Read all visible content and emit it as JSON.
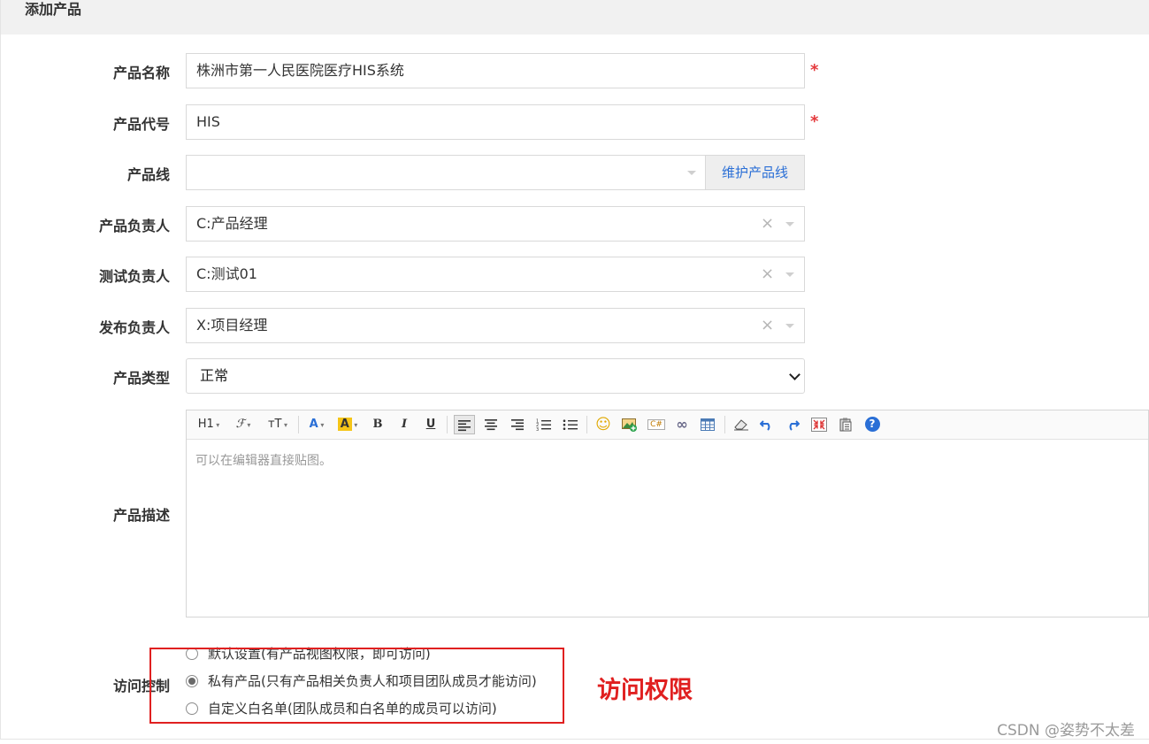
{
  "page": {
    "title": "添加产品"
  },
  "form": {
    "name": {
      "label": "产品名称",
      "value": "株洲市第一人民医院医疗HIS系统",
      "required_mark": "*"
    },
    "code": {
      "label": "产品代号",
      "value": "HIS",
      "required_mark": "*"
    },
    "line": {
      "label": "产品线",
      "value": "",
      "button": "维护产品线"
    },
    "owner": {
      "label": "产品负责人",
      "value": "C:产品经理",
      "clear": "×"
    },
    "tester": {
      "label": "测试负责人",
      "value": "C:测试01",
      "clear": "×"
    },
    "release": {
      "label": "发布负责人",
      "value": "X:项目经理",
      "clear": "×"
    },
    "type": {
      "label": "产品类型",
      "value": "正常"
    },
    "desc": {
      "label": "产品描述",
      "placeholder": "可以在编辑器直接贴图。",
      "toolbar": {
        "heading": "H1",
        "font": "ℱ",
        "size": "тT",
        "font_color": "A",
        "bg_color": "A",
        "bold": "B",
        "italic": "I",
        "underline": "U",
        "emoji": "☺",
        "code": "C#",
        "link": "∞",
        "help": "?"
      }
    },
    "acl": {
      "label": "访问控制",
      "options": [
        {
          "text": "默认设置(有产品视图权限，即可访问)",
          "checked": false
        },
        {
          "text": "私有产品(只有产品相关负责人和项目团队成员才能访问)",
          "checked": true
        },
        {
          "text": "自定义白名单(团队成员和白名单的成员可以访问)",
          "checked": false
        }
      ]
    }
  },
  "annotation": {
    "text": "访问权限",
    "color": "#e02020"
  },
  "watermark": "CSDN @姿势不太差",
  "colors": {
    "required": "#e4393c",
    "link": "#2a6fd6",
    "header_bg": "#f1f1f1"
  }
}
